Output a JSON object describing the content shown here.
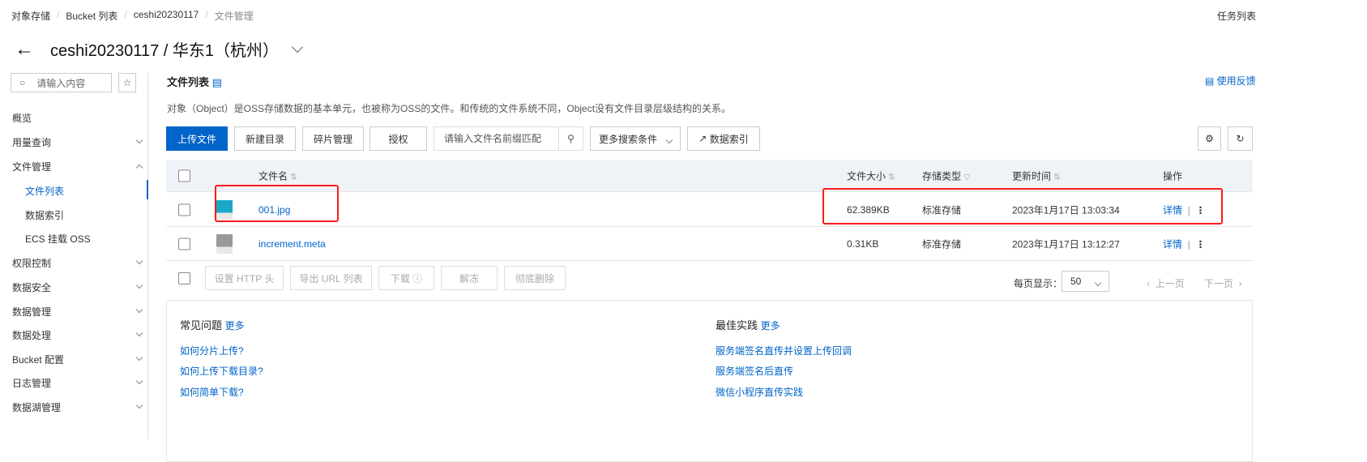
{
  "breadcrumb": [
    "对象存储",
    "Bucket 列表",
    "ceshi20230117",
    "文件管理"
  ],
  "task_list": "任务列表",
  "title": "ceshi20230117 / 华东1（杭州）",
  "sidebar": {
    "search_placeholder": "请输入内容",
    "items": [
      {
        "label": "概览"
      },
      {
        "label": "用量查询"
      },
      {
        "label": "文件管理"
      },
      {
        "label": "文件列表"
      },
      {
        "label": "数据索引"
      },
      {
        "label": "ECS 挂载 OSS"
      },
      {
        "label": "权限控制"
      },
      {
        "label": "数据安全"
      },
      {
        "label": "数据管理"
      },
      {
        "label": "数据处理"
      },
      {
        "label": "Bucket 配置"
      },
      {
        "label": "日志管理"
      },
      {
        "label": "数据湖管理"
      }
    ]
  },
  "main": {
    "section_title": "文件列表",
    "feedback": "使用反馈",
    "description": "对象（Object）是OSS存储数据的基本单元，也被称为OSS的文件。和传统的文件系统不同，Object没有文件目录层级结构的关系。",
    "toolbar": {
      "upload": "上传文件",
      "new_dir": "新建目录",
      "fragments": "碎片管理",
      "authorize": "授权",
      "search_placeholder": "请输入文件名前缀匹配",
      "more_search": "更多搜索条件",
      "data_index": "数据索引"
    },
    "columns": {
      "name": "文件名",
      "size": "文件大小",
      "storage": "存储类型",
      "updated": "更新时间",
      "actions": "操作"
    },
    "rows": [
      {
        "name": "001.jpg",
        "size": "62.389KB",
        "storage": "标准存储",
        "updated": "2023年1月17日 13:03:34",
        "detail": "详情"
      },
      {
        "name": "increment.meta",
        "size": "0.31KB",
        "storage": "标准存储",
        "updated": "2023年1月17日 13:12:27",
        "detail": "详情"
      }
    ],
    "bulk": {
      "http_header": "设置 HTTP 头",
      "export_url": "导出 URL 列表",
      "download": "下载",
      "unfreeze": "解冻",
      "delete": "彻底删除"
    },
    "pagination": {
      "per_page_label": "每页显示：",
      "per_page": "50",
      "prev": "上一页",
      "next": "下一页"
    },
    "faq": {
      "title": "常见问题",
      "more": "更多",
      "items": [
        "如何分片上传?",
        "如何上传下载目录?",
        "如何简单下载?"
      ]
    },
    "best": {
      "title": "最佳实践",
      "more": "更多",
      "items": [
        "服务端签名直传并设置上传回调",
        "服务端签名后直传",
        "微信小程序直传实践"
      ]
    }
  }
}
